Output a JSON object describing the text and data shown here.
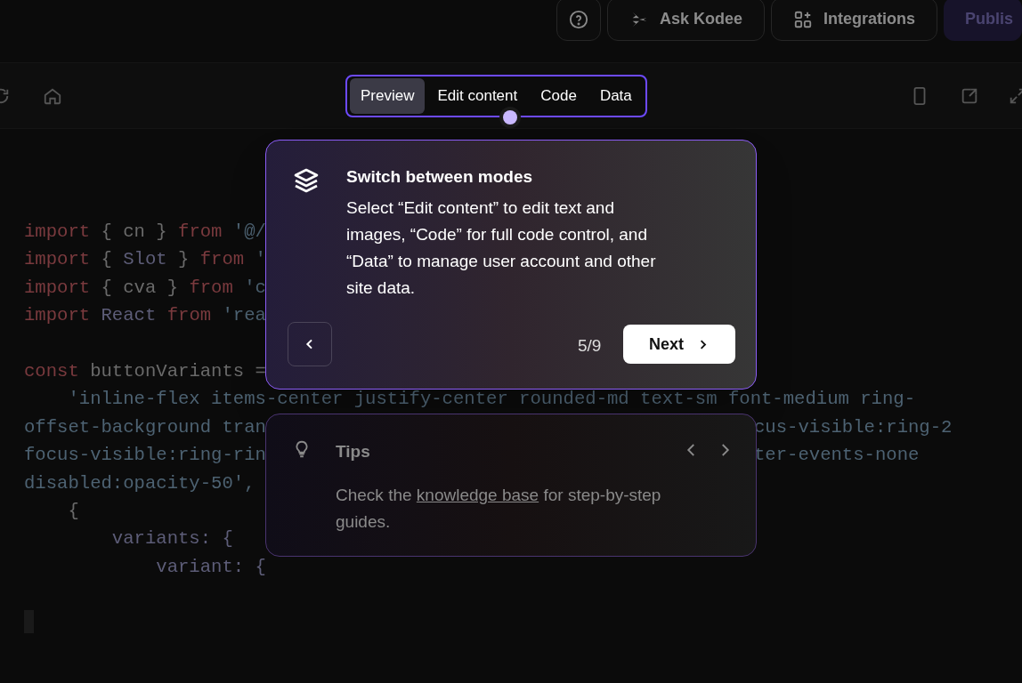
{
  "top_bar": {
    "buttons": [
      {
        "label": "Ask Kodee",
        "kind": "secondary"
      },
      {
        "label": "Integrations",
        "kind": "secondary"
      },
      {
        "label": "Publis",
        "kind": "primary"
      }
    ]
  },
  "mode_tabs": [
    {
      "label": "Preview",
      "selected": true
    },
    {
      "label": "Edit content",
      "selected": false
    },
    {
      "label": "Code",
      "selected": false
    },
    {
      "label": "Data",
      "selected": false
    }
  ],
  "code_blocks": [
    {
      "lines": [
        {
          "segments": [
            {
              "text": "import",
              "kind": "keyword"
            },
            {
              "text": " { cn } ",
              "kind": "plain"
            },
            {
              "text": "from",
              "kind": "keyword"
            },
            {
              "text": " '@/",
              "kind": "string"
            }
          ]
        },
        {
          "segments": [
            {
              "text": "import",
              "kind": "keyword"
            },
            {
              "text": " { ",
              "kind": "plain"
            },
            {
              "text": "Slot",
              "kind": "name"
            },
            {
              "text": " } ",
              "kind": "plain"
            },
            {
              "text": "from",
              "kind": "keyword"
            },
            {
              "text": " '",
              "kind": "string"
            }
          ]
        },
        {
          "segments": [
            {
              "text": "import",
              "kind": "keyword"
            },
            {
              "text": " { cva } ",
              "kind": "plain"
            },
            {
              "text": "from",
              "kind": "keyword"
            },
            {
              "text": " 'c",
              "kind": "string"
            }
          ]
        },
        {
          "segments": [
            {
              "text": "import",
              "kind": "keyword"
            },
            {
              "text": " React",
              "kind": "name"
            },
            {
              "text": " from",
              "kind": "keyword"
            },
            {
              "text": " 'rea",
              "kind": "string"
            }
          ]
        }
      ]
    },
    {
      "lines": [
        {
          "segments": [
            {
              "text": "const",
              "kind": "keyword"
            },
            {
              "text": " buttonVariants =",
              "kind": "plain"
            }
          ]
        },
        {
          "segments": [
            {
              "text": "    'inline-flex items-center justify-center rounded-md text-sm font-medium ring-",
              "kind": "string"
            }
          ]
        },
        {
          "segments": [
            {
              "text": "offset-background tran",
              "kind": "string"
            }
          ],
          "right": "cus-visible:ring-2"
        },
        {
          "segments": [
            {
              "text": "focus-visible:ring-rin",
              "kind": "string"
            }
          ],
          "right": "ter-events-none"
        },
        {
          "segments": [
            {
              "text": "disabled:opacity-50',",
              "kind": "string"
            }
          ]
        },
        {
          "segments": [
            {
              "text": "    {",
              "kind": "plain"
            }
          ]
        },
        {
          "segments": [
            {
              "text": "        variants: {",
              "kind": "name"
            }
          ]
        },
        {
          "segments": [
            {
              "text": "            variant: {",
              "kind": "name"
            }
          ]
        }
      ]
    }
  ],
  "tour": {
    "title": "Switch between modes",
    "body": "Select “Edit content” to edit text and images, “Code” for full code control, and “Data” to manage user account and other site data.",
    "step": "5/9",
    "next": "Next"
  },
  "tips": {
    "title": "Tips",
    "body_before": "Check the",
    "link": "knowledge base",
    "body_after": "for step-by-step guides."
  }
}
